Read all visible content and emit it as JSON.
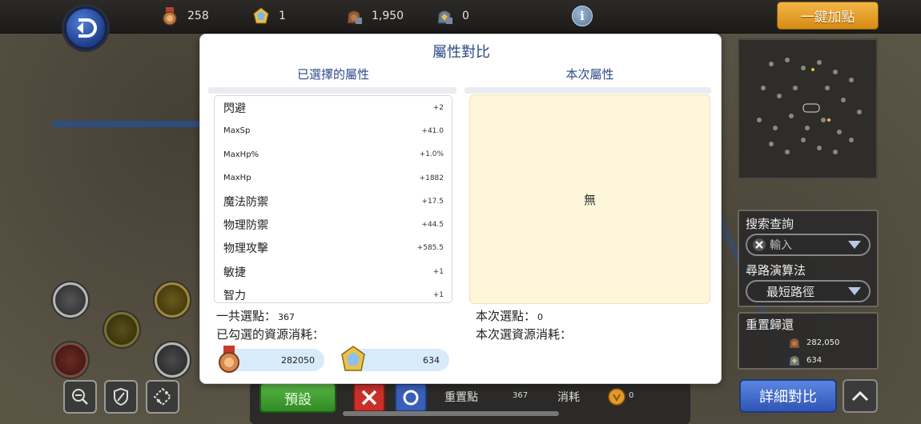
{
  "topbar": {
    "resources": [
      {
        "icon": "bronze-medal-icon",
        "value": "258"
      },
      {
        "icon": "gold-crystal-icon",
        "value": "1"
      },
      {
        "icon": "medal-bag-icon",
        "value": "1,950"
      },
      {
        "icon": "crystal-bag-icon",
        "value": "0"
      }
    ],
    "info_label": "i",
    "one_click_label": "一鍵加點"
  },
  "modal": {
    "title": "屬性對比",
    "left_title": "已選擇的屬性",
    "right_title": "本次屬性",
    "attributes": [
      {
        "name": "閃避",
        "value": "+2"
      },
      {
        "name": "MaxSp",
        "value": "+41.0"
      },
      {
        "name": "MaxHp%",
        "value": "+1.0%"
      },
      {
        "name": "MaxHp",
        "value": "+1882"
      },
      {
        "name": "魔法防禦",
        "value": "+17.5"
      },
      {
        "name": "物理防禦",
        "value": "+44.5"
      },
      {
        "name": "物理攻擊",
        "value": "+585.5"
      },
      {
        "name": "敏捷",
        "value": "+1"
      },
      {
        "name": "智力",
        "value": "+1"
      }
    ],
    "empty_text": "無",
    "total_points_label": "一共選點：",
    "total_points_value": "367",
    "checked_cost_label": "已勾選的資源消耗：",
    "cost_medal_value": "282050",
    "cost_crystal_value": "634",
    "current_points_label": "本次選點：",
    "current_points_value": "0",
    "current_cost_label": "本次選資源消耗："
  },
  "side": {
    "search_label": "搜索查詢",
    "search_placeholder": "輸入",
    "algo_label": "尋路演算法",
    "algo_value": "最短路徑",
    "reset_label": "重置歸還",
    "reset_medal_value": "282,050",
    "reset_crystal_value": "634",
    "detail_label": "詳細對比"
  },
  "bottom": {
    "preset_label": "預設",
    "reset_points_label": "重置點",
    "reset_points_value": "367",
    "cost_label": "消耗",
    "cost_value": "0"
  },
  "colors": {
    "accent_blue": "#2c4a86",
    "gold_button": "#e8a22c",
    "green_button": "#44a035",
    "detail_button": "#3d68cc",
    "empty_bg": "#fdf6da",
    "pill_bg": "#d8ebfb"
  }
}
